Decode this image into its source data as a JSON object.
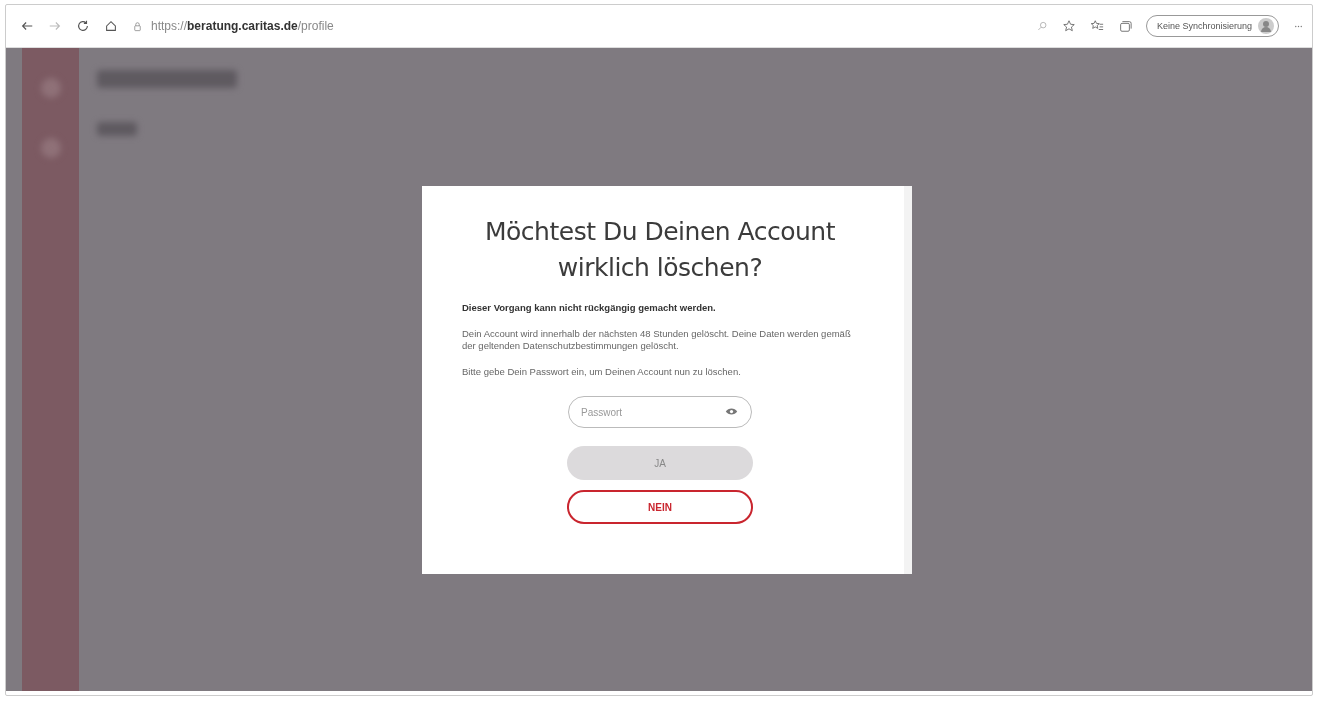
{
  "browser": {
    "url": "https://**beratung.caritas.de**/profile",
    "sync_label": "Keine Synchronisierung"
  },
  "dialog": {
    "title": "Möchtest Du Deinen Account wirklich löschen?",
    "warning": "Dieser Vorgang kann nicht rückgängig gemacht werden.",
    "body": "Dein Account wird innerhalb der nächsten 48 Stunden gelöscht. Deine Daten werden gemäß der geltenden Datenschutzbestimmungen gelöscht.",
    "instruction": "Bitte gebe Dein Passwort ein, um Deinen Account nun zu löschen.",
    "password": {
      "placeholder": "Passwort"
    },
    "buttons": [
      {
        "label": "JA",
        "kind": "primary",
        "disabled": true
      },
      {
        "label": "NEIN",
        "kind": "outline",
        "disabled": false
      }
    ]
  }
}
